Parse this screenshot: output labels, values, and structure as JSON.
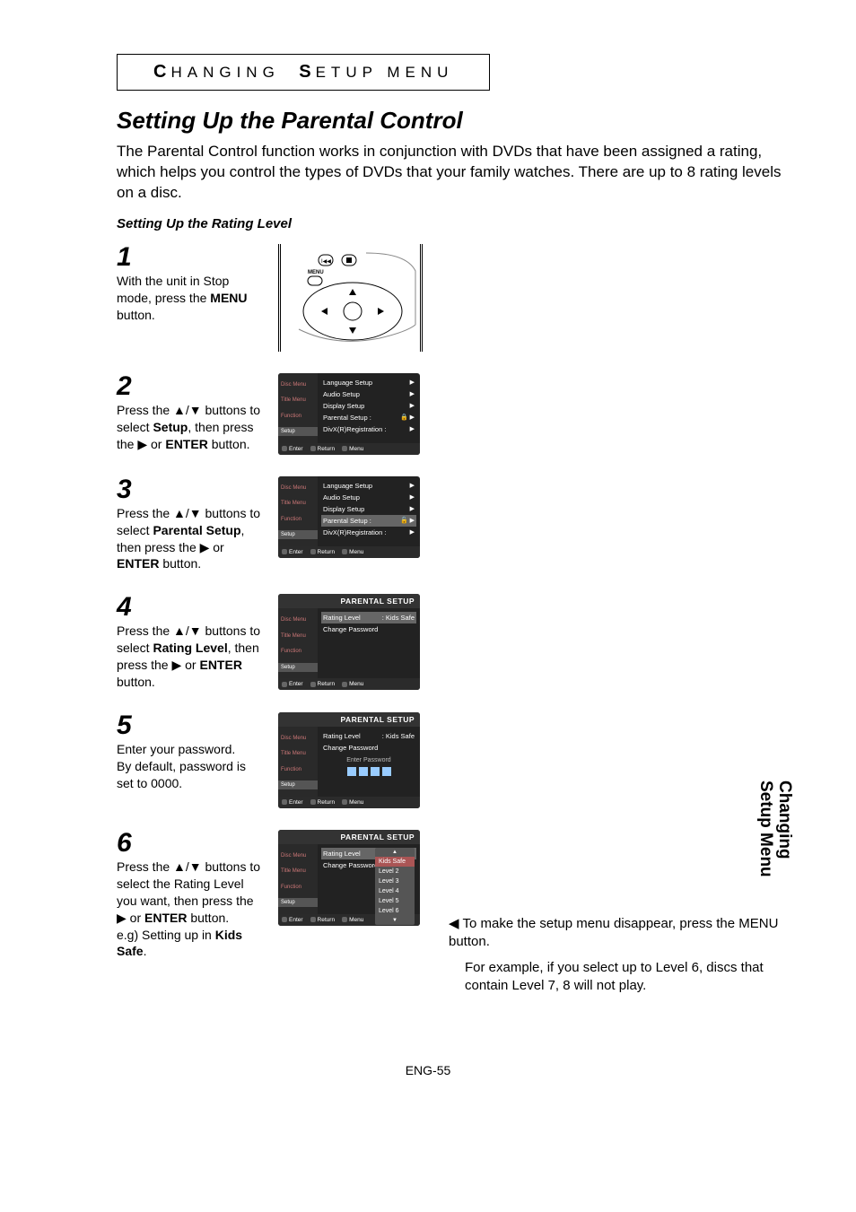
{
  "banner": {
    "c1": "C",
    "w1": "HANGING",
    "c2": "S",
    "w2": "ETUP MENU"
  },
  "h1": "Setting Up the Parental Control",
  "intro": "The Parental Control function works in conjunction with DVDs that have been assigned a rating, which helps you control the types of DVDs that your family watches. There are up to 8 rating levels on a disc.",
  "sub": "Setting Up the Rating Level",
  "side_tab": "Changing\nSetup Menu",
  "steps": {
    "s1": {
      "n": "1",
      "text_a": "With the unit in Stop mode, press the ",
      "b": "MENU",
      "text_c": " button."
    },
    "s2": {
      "n": "2",
      "text_a": "Press the ▲/▼ buttons to select ",
      "b": "Setup",
      "text_c": ", then press the ▶ or ",
      "b2": "ENTER",
      "text_d": " button."
    },
    "s3": {
      "n": "3",
      "text_a": "Press the ▲/▼ buttons to select ",
      "b": "Parental Setup",
      "text_c": ", then press the ▶ or ",
      "b2": "ENTER",
      "text_d": " button."
    },
    "s4": {
      "n": "4",
      "text_a": "Press the ▲/▼ buttons to select ",
      "b": "Rating Level",
      "text_c": ", then press the ▶ or ",
      "b2": "ENTER",
      "text_d": " button."
    },
    "s5": {
      "n": "5",
      "text_a": "Enter your password.",
      "text_b": "By default, password is set to 0000."
    },
    "s6": {
      "n": "6",
      "text_a": "Press the ▲/▼ buttons to select the Rating Level you want, then press the ▶ or ",
      "b": "ENTER",
      "text_c": " button.",
      "text_d": "e.g) Setting up in ",
      "b2": "Kids Safe",
      "text_e": "."
    }
  },
  "osd_sidebar": {
    "0": "Disc Menu",
    "1": "Title Menu",
    "2": "Function",
    "3": "Setup"
  },
  "osd_footer": {
    "e": "Enter",
    "r": "Return",
    "m": "Menu"
  },
  "menu_main": {
    "0": "Language Setup",
    "1": "Audio Setup",
    "2": "Display Setup",
    "3": "Parental Setup :",
    "4": "DivX(R)Registration :"
  },
  "parental_title": "PARENTAL SETUP",
  "parental_rows": {
    "rl": "Rating Level",
    "rl_val": ": Kids Safe",
    "cp": "Change Password"
  },
  "enter_pw": "Enter Password",
  "levels": {
    "0": "Kids Safe",
    "1": "Level 2",
    "2": "Level 3",
    "3": "Level 4",
    "4": "Level 5",
    "5": "Level 6"
  },
  "note": {
    "l1": "To make the setup menu disappear, press the MENU button.",
    "l2": "For example, if you select up to Level 6, discs that contain Level 7, 8 will not play."
  },
  "pagenum": "ENG-55"
}
